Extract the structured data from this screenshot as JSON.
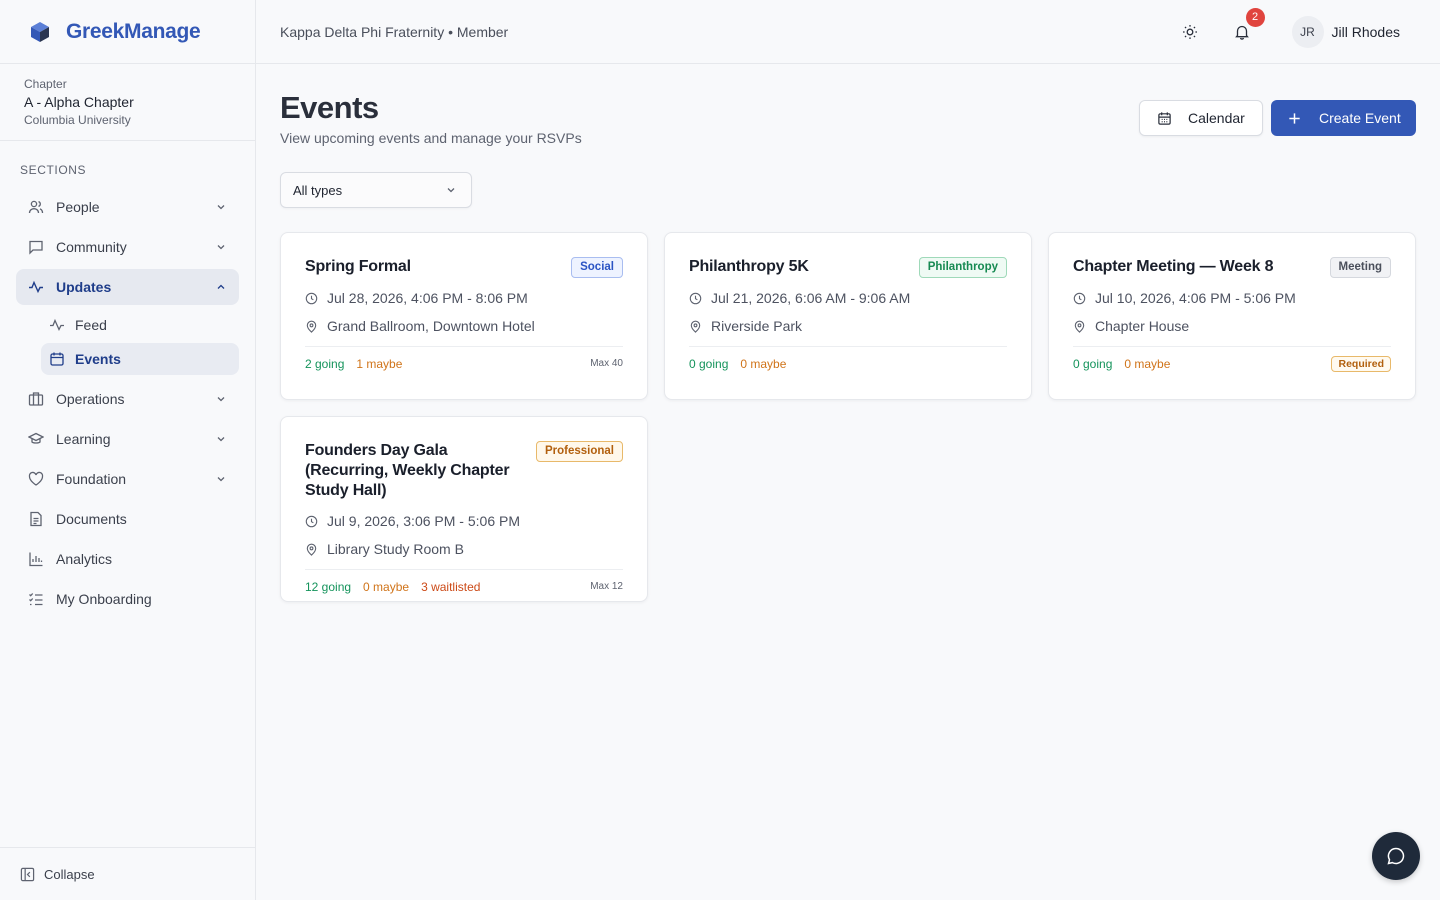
{
  "brand": {
    "name": "GreekManage"
  },
  "chapter": {
    "label": "Chapter",
    "name": "A - Alpha Chapter",
    "school": "Columbia University"
  },
  "sidebar": {
    "sections_label": "SECTIONS",
    "items": [
      {
        "label": "People",
        "icon": "people-icon"
      },
      {
        "label": "Community",
        "icon": "message-square-icon"
      },
      {
        "label": "Updates",
        "icon": "activity-icon"
      },
      {
        "label": "Feed",
        "icon": "activity-icon"
      },
      {
        "label": "Events",
        "icon": "calendar-icon"
      },
      {
        "label": "Operations",
        "icon": "building-icon"
      },
      {
        "label": "Learning",
        "icon": "graduation-cap-icon"
      },
      {
        "label": "Foundation",
        "icon": "heart-icon"
      },
      {
        "label": "Documents",
        "icon": "file-icon"
      },
      {
        "label": "Analytics",
        "icon": "bar-chart-icon"
      },
      {
        "label": "My Onboarding",
        "icon": "checklist-icon"
      }
    ],
    "collapse_label": "Collapse"
  },
  "header": {
    "org": "Kappa Delta Phi Fraternity • Member",
    "notification_count": "2",
    "user_initials": "JR",
    "user_name": "Jill Rhodes"
  },
  "page": {
    "title": "Events",
    "subtitle": "View upcoming events and manage your RSVPs",
    "calendar_label": "Calendar",
    "create_label": "Create Event",
    "filter_value": "All types"
  },
  "colors": {
    "accent": "#3358b6",
    "going": "#14935b",
    "maybe": "#d0741a",
    "waitlisted": "#cc4a17"
  },
  "events": [
    {
      "title": "Spring Formal",
      "tag": "Social",
      "tag_color": "#2b54c4",
      "tag_bg": "#eef3ff",
      "tag_border": "#a9bdf0",
      "time": "Jul 28, 2026, 4:06 PM - 8:06 PM",
      "location": "Grand Ballroom, Downtown Hotel",
      "going": "2 going",
      "maybe": "1 maybe",
      "extra": "Max 40"
    },
    {
      "title": "Philanthropy 5K",
      "tag": "Philanthropy",
      "tag_color": "#168a52",
      "tag_bg": "#effaf4",
      "tag_border": "#9fd9b9",
      "time": "Jul 21, 2026, 6:06 AM - 9:06 AM",
      "location": "Riverside Park",
      "going": "0 going",
      "maybe": "0 maybe",
      "extra": ""
    },
    {
      "title": "Chapter Meeting — Week 8",
      "tag": "Meeting",
      "tag_color": "#4a4f5b",
      "tag_bg": "#f1f2f5",
      "tag_border": "#d5d8de",
      "time": "Jul 10, 2026, 4:06 PM - 5:06 PM",
      "location": "Chapter House",
      "going": "0 going",
      "maybe": "0 maybe",
      "required": "Required"
    },
    {
      "title": "Founders Day Gala (Recurring, Weekly Chapter Study Hall)",
      "tag": "Professional",
      "tag_color": "#b2600e",
      "tag_bg": "#fff8eb",
      "tag_border": "#e8b96a",
      "time": "Jul 9, 2026, 3:06 PM - 5:06 PM",
      "location": "Library Study Room B",
      "going": "12 going",
      "maybe": "0 maybe",
      "waitlisted": "3 waitlisted",
      "extra": "Max 12"
    }
  ]
}
